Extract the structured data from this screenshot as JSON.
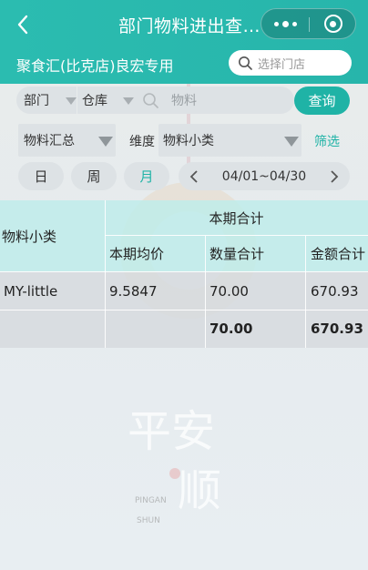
{
  "header": {
    "title": "部门物料进出查…",
    "store_name": "聚食汇(比克店)良宏专用",
    "store_search_placeholder": "选择门店"
  },
  "filters": {
    "department": "部门",
    "warehouse": "仓库",
    "material_placeholder": "物料",
    "query_label": "查询",
    "summary_select": "物料汇总",
    "dimension_label": "维度",
    "dimension_value": "物料小类",
    "filter_link": "筛选"
  },
  "period": {
    "day": "日",
    "week": "周",
    "month": "月",
    "selected": "月",
    "range": "04/01~04/30"
  },
  "table": {
    "col_category": "物料小类",
    "group_header": "本期合计",
    "col_avg_price": "本期均价",
    "col_qty_total": "数量合计",
    "col_amount_total": "金额合计",
    "rows": [
      {
        "category": "MY-little",
        "avg_price": "9.5847",
        "qty": "70.00",
        "amount": "670.93"
      }
    ],
    "totals": {
      "qty": "70.00",
      "amount": "670.93"
    }
  },
  "watermark": {
    "text": "平安顺",
    "pinyin_1": "PINGAN",
    "pinyin_2": "SHUN"
  },
  "colors": {
    "accent": "#1fb3a6",
    "header_bg": "#2bbcb0"
  }
}
